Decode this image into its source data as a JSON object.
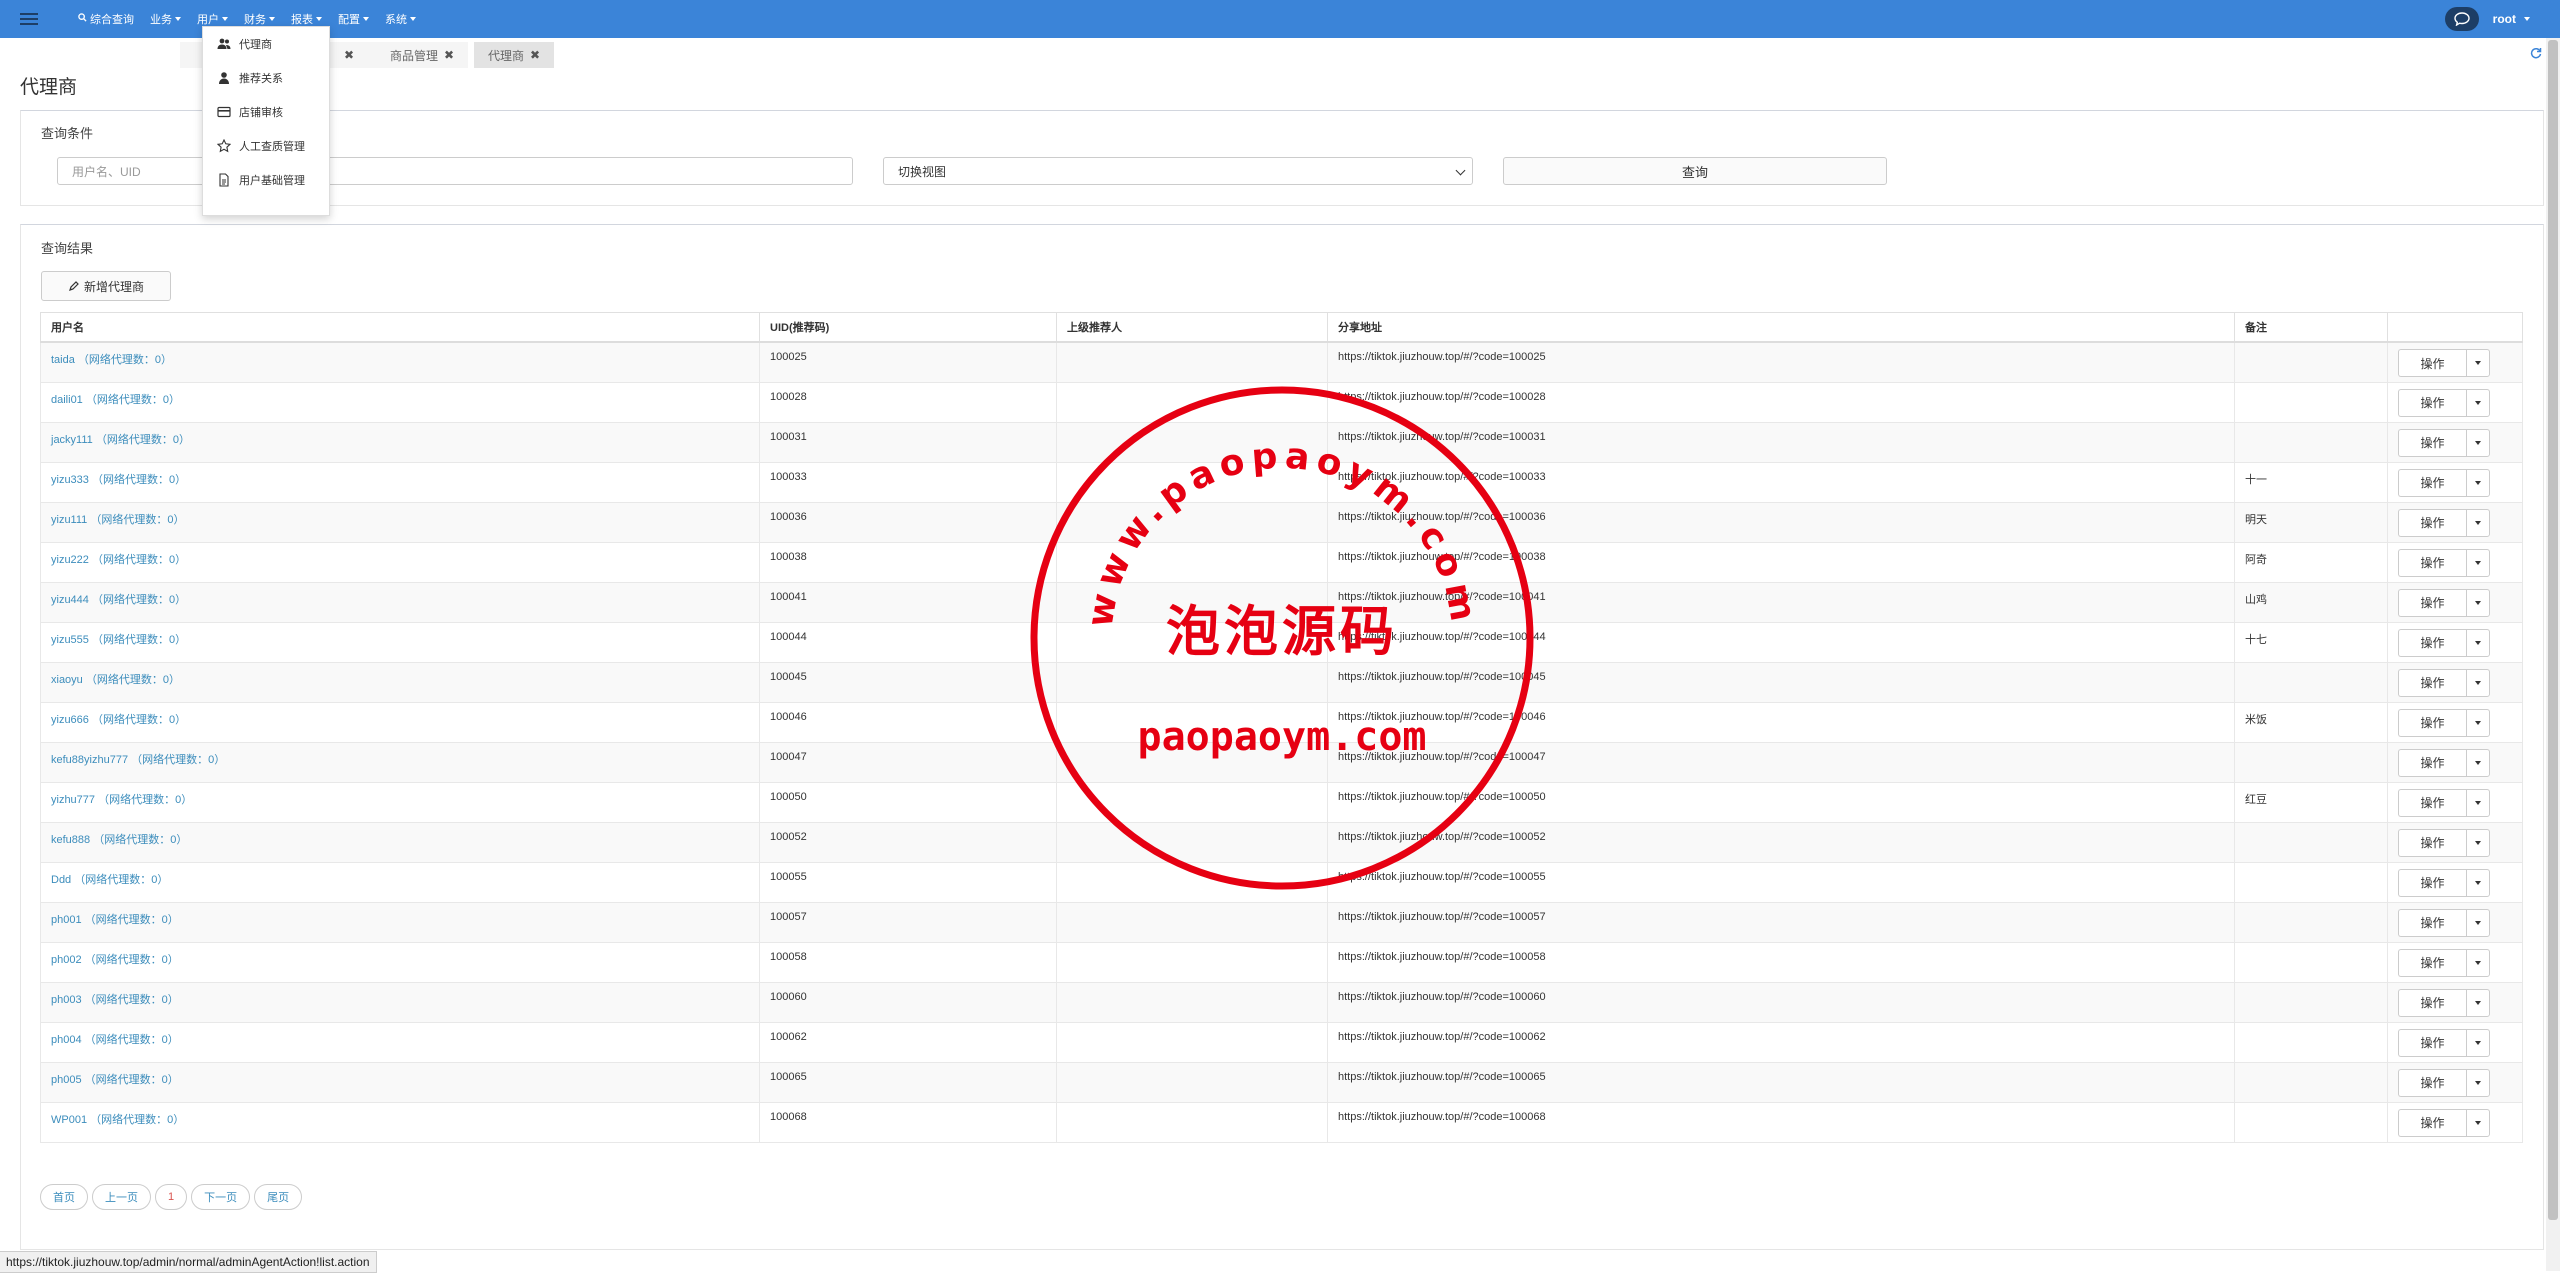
{
  "navbar": {
    "menu": [
      {
        "label": "综合查询",
        "caret": false
      },
      {
        "label": "业务",
        "caret": true
      },
      {
        "label": "用户",
        "caret": true
      },
      {
        "label": "财务",
        "caret": true
      },
      {
        "label": "报表",
        "caret": true
      },
      {
        "label": "配置",
        "caret": true
      },
      {
        "label": "系统",
        "caret": true
      }
    ],
    "user": "root"
  },
  "user_dropdown": [
    {
      "label": "代理商",
      "icon": "users-icon"
    },
    {
      "label": "推荐关系",
      "icon": "user-icon"
    },
    {
      "label": "店铺审核",
      "icon": "credit-card-icon"
    },
    {
      "label": "人工查质管理",
      "icon": "star-icon"
    },
    {
      "label": "用户基础管理",
      "icon": "document-icon"
    }
  ],
  "tabs": [
    {
      "label": "",
      "active": false
    },
    {
      "label": "商品管理",
      "active": false
    },
    {
      "label": "代理商",
      "active": true
    }
  ],
  "page_title": "代理商",
  "filter": {
    "title": "查询条件",
    "search_placeholder": "用户名、UID",
    "view_select": "切换视图",
    "query_button": "查询"
  },
  "results": {
    "title": "查询结果",
    "add_button": "新增代理商",
    "columns": [
      "用户名",
      "UID(推荐码)",
      "上级推荐人",
      "分享地址",
      "备注",
      ""
    ],
    "op_label": "操作",
    "rows": [
      {
        "name": "taida",
        "sub": "（网络代理数：0）",
        "uid": "100025",
        "parent": "",
        "url": "https://tiktok.jiuzhouw.top/#/?code=100025",
        "note": ""
      },
      {
        "name": "daili01",
        "sub": "（网络代理数：0）",
        "uid": "100028",
        "parent": "",
        "url": "https://tiktok.jiuzhouw.top/#/?code=100028",
        "note": ""
      },
      {
        "name": "jacky111",
        "sub": "（网络代理数：0）",
        "uid": "100031",
        "parent": "",
        "url": "https://tiktok.jiuzhouw.top/#/?code=100031",
        "note": ""
      },
      {
        "name": "yizu333",
        "sub": "（网络代理数：0）",
        "uid": "100033",
        "parent": "",
        "url": "https://tiktok.jiuzhouw.top/#/?code=100033",
        "note": "十一"
      },
      {
        "name": "yizu111",
        "sub": "（网络代理数：0）",
        "uid": "100036",
        "parent": "",
        "url": "https://tiktok.jiuzhouw.top/#/?code=100036",
        "note": "明天"
      },
      {
        "name": "yizu222",
        "sub": "（网络代理数：0）",
        "uid": "100038",
        "parent": "",
        "url": "https://tiktok.jiuzhouw.top/#/?code=100038",
        "note": "阿奇"
      },
      {
        "name": "yizu444",
        "sub": "（网络代理数：0）",
        "uid": "100041",
        "parent": "",
        "url": "https://tiktok.jiuzhouw.top/#/?code=100041",
        "note": "山鸡"
      },
      {
        "name": "yizu555",
        "sub": "（网络代理数：0）",
        "uid": "100044",
        "parent": "",
        "url": "https://tiktok.jiuzhouw.top/#/?code=100044",
        "note": "十七"
      },
      {
        "name": "xiaoyu",
        "sub": "（网络代理数：0）",
        "uid": "100045",
        "parent": "",
        "url": "https://tiktok.jiuzhouw.top/#/?code=100045",
        "note": ""
      },
      {
        "name": "yizu666",
        "sub": "（网络代理数：0）",
        "uid": "100046",
        "parent": "",
        "url": "https://tiktok.jiuzhouw.top/#/?code=100046",
        "note": "米饭"
      },
      {
        "name": "kefu88yizhu777",
        "sub": "（网络代理数：0）",
        "uid": "100047",
        "parent": "",
        "url": "https://tiktok.jiuzhouw.top/#/?code=100047",
        "note": ""
      },
      {
        "name": "yizhu777",
        "sub": "（网络代理数：0）",
        "uid": "100050",
        "parent": "",
        "url": "https://tiktok.jiuzhouw.top/#/?code=100050",
        "note": "红豆"
      },
      {
        "name": "kefu888",
        "sub": "（网络代理数：0）",
        "uid": "100052",
        "parent": "",
        "url": "https://tiktok.jiuzhouw.top/#/?code=100052",
        "note": ""
      },
      {
        "name": "Ddd",
        "sub": "（网络代理数：0）",
        "uid": "100055",
        "parent": "",
        "url": "https://tiktok.jiuzhouw.top/#/?code=100055",
        "note": ""
      },
      {
        "name": "ph001",
        "sub": "（网络代理数：0）",
        "uid": "100057",
        "parent": "",
        "url": "https://tiktok.jiuzhouw.top/#/?code=100057",
        "note": ""
      },
      {
        "name": "ph002",
        "sub": "（网络代理数：0）",
        "uid": "100058",
        "parent": "",
        "url": "https://tiktok.jiuzhouw.top/#/?code=100058",
        "note": ""
      },
      {
        "name": "ph003",
        "sub": "（网络代理数：0）",
        "uid": "100060",
        "parent": "",
        "url": "https://tiktok.jiuzhouw.top/#/?code=100060",
        "note": ""
      },
      {
        "name": "ph004",
        "sub": "（网络代理数：0）",
        "uid": "100062",
        "parent": "",
        "url": "https://tiktok.jiuzhouw.top/#/?code=100062",
        "note": ""
      },
      {
        "name": "ph005",
        "sub": "（网络代理数：0）",
        "uid": "100065",
        "parent": "",
        "url": "https://tiktok.jiuzhouw.top/#/?code=100065",
        "note": ""
      },
      {
        "name": "WP001",
        "sub": "（网络代理数：0）",
        "uid": "100068",
        "parent": "",
        "url": "https://tiktok.jiuzhouw.top/#/?code=100068",
        "note": ""
      }
    ]
  },
  "pagination": {
    "first": "首页",
    "prev": "上一页",
    "current": "1",
    "next": "下一页",
    "last": "尾页"
  },
  "status_url": "https://tiktok.jiuzhouw.top/admin/normal/adminAgentAction!list.action",
  "watermark": {
    "top_text": "www.paopaoym.com",
    "center_text": "泡泡源码",
    "bottom_text": "paopaoym.com",
    "color": "#e60012"
  }
}
